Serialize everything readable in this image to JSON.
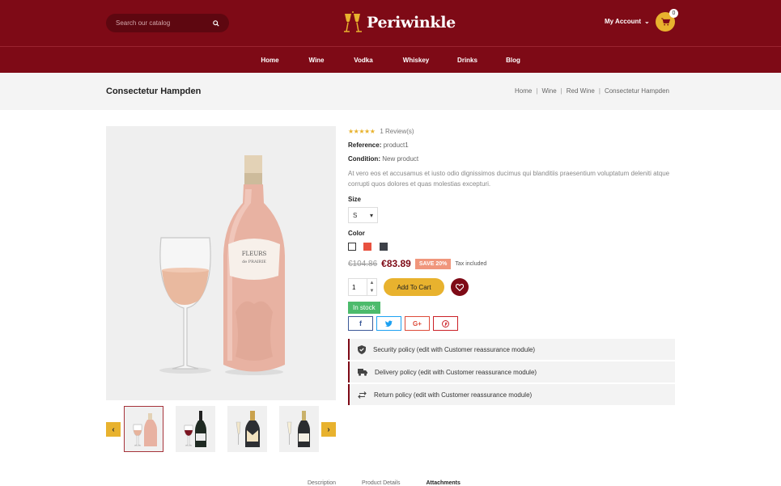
{
  "header": {
    "search_placeholder": "Search our catalog",
    "logo_text": "Periwinkle",
    "account_label": "My Account",
    "cart_count": "0"
  },
  "nav": [
    "Home",
    "Wine",
    "Vodka",
    "Whiskey",
    "Drinks",
    "Blog"
  ],
  "page": {
    "title": "Consectetur Hampden",
    "breadcrumb": [
      "Home",
      "Wine",
      "Red Wine",
      "Consectetur Hampden"
    ]
  },
  "product": {
    "stars": "★★★★★",
    "reviews": "1 Review(s)",
    "reference_label": "Reference:",
    "reference_value": "product1",
    "condition_label": "Condition:",
    "condition_value": "New product",
    "description": "At vero eos et accusamus et iusto odio dignissimos ducimus qui blanditiis praesentium voluptatum deleniti atque corrupti quos dolores et quas molestias excepturi.",
    "size_label": "Size",
    "size_value": "S",
    "color_label": "Color",
    "colors": [
      "#ffffff",
      "#e8513f",
      "#3d4148"
    ],
    "old_price": "€104.86",
    "price": "€83.89",
    "save_badge": "SAVE 20%",
    "tax_note": "Tax included",
    "quantity": "1",
    "add_to_cart": "Add To Cart",
    "stock": "In stock",
    "bottle_label_1": "FLEURS",
    "bottle_label_2": "de PRAIRIE"
  },
  "share": [
    {
      "icon": "facebook-icon",
      "glyph": "f",
      "color": "#3b5998"
    },
    {
      "icon": "twitter-icon",
      "glyph": "🐦",
      "color": "#1da1f2"
    },
    {
      "icon": "google-plus-icon",
      "glyph": "G+",
      "color": "#dd4b39"
    },
    {
      "icon": "pinterest-icon",
      "glyph": "℗",
      "color": "#cb2027"
    }
  ],
  "policies": [
    {
      "icon": "shield-icon",
      "text": "Security policy (edit with Customer reassurance module)"
    },
    {
      "icon": "truck-icon",
      "text": "Delivery policy (edit with Customer reassurance module)"
    },
    {
      "icon": "return-arrows-icon",
      "text": "Return policy (edit with Customer reassurance module)"
    }
  ],
  "tabs": [
    "Description",
    "Product Details",
    "Attachments"
  ],
  "colors": {
    "brand": "#7e0a16",
    "accent": "#e8b22e",
    "stock": "#4cbb6c",
    "save": "#f0967c"
  }
}
